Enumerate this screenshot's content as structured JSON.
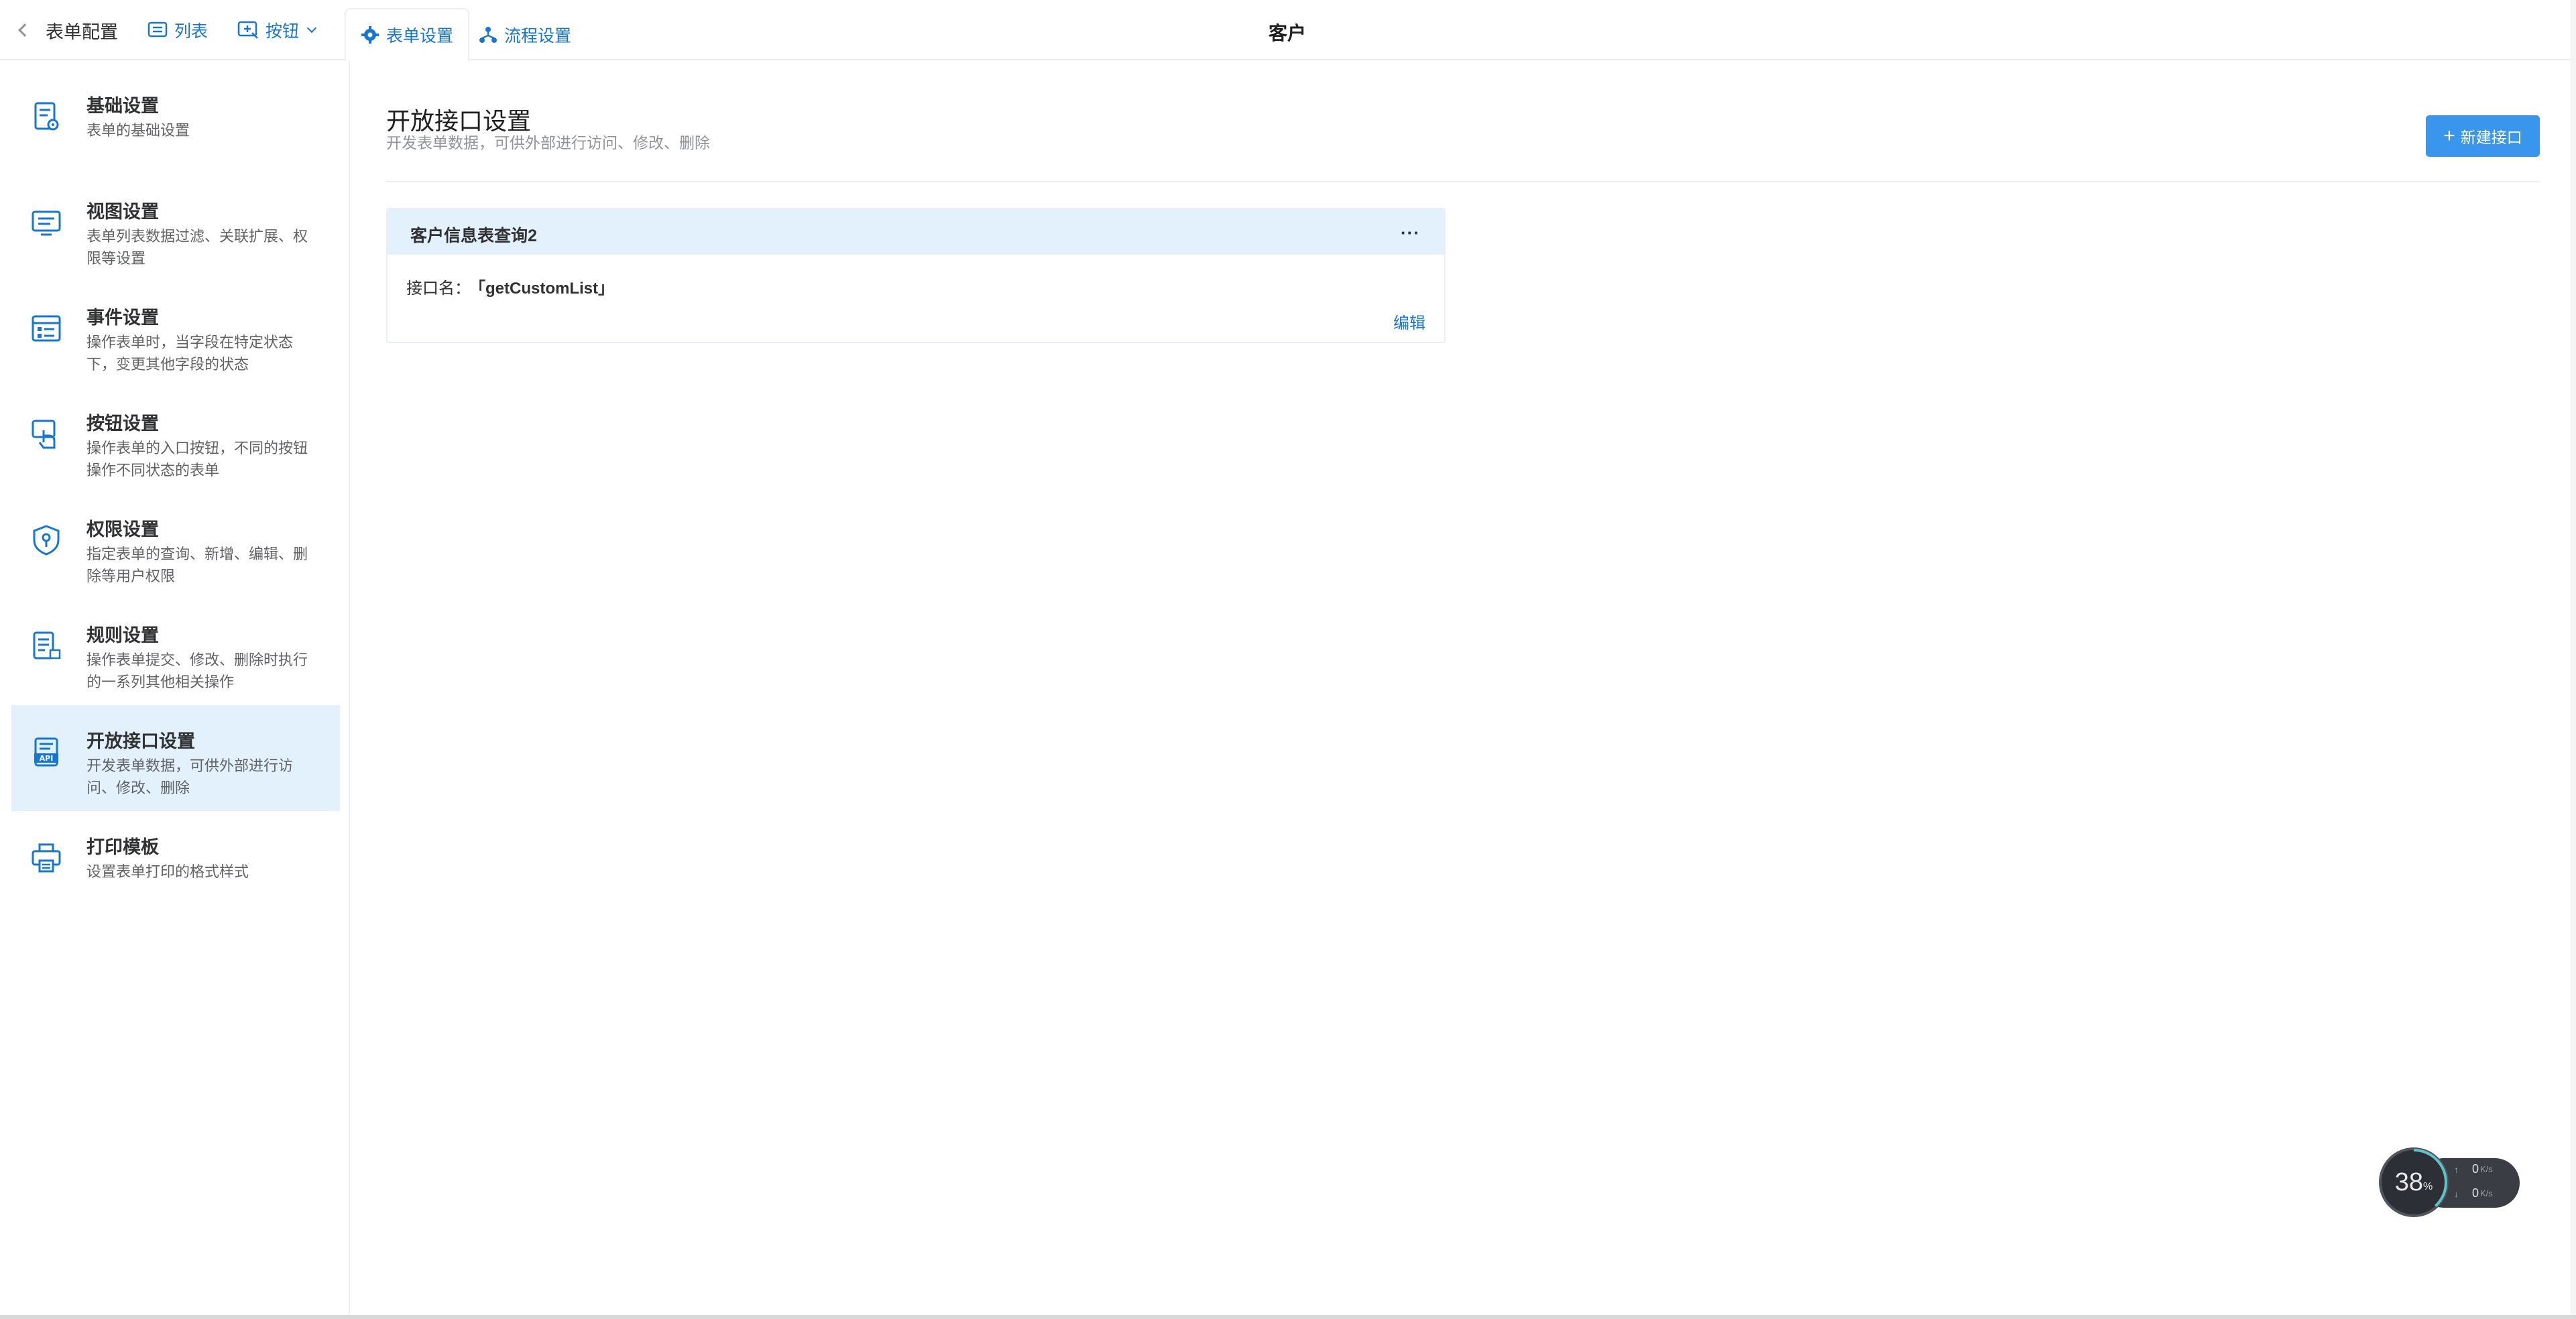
{
  "topbar": {
    "back_label": "表单配置",
    "list_label": "列表",
    "button_label": "按钮",
    "tabs": [
      {
        "label": "表单设置"
      },
      {
        "label": "流程设置"
      }
    ],
    "page_title": "客户"
  },
  "sidebar": {
    "items": [
      {
        "title": "基础设置",
        "desc": "表单的基础设置",
        "icon": "form-settings-icon"
      },
      {
        "title": "视图设置",
        "desc": "表单列表数据过滤、关联扩展、权限等设置",
        "icon": "monitor-icon"
      },
      {
        "title": "事件设置",
        "desc": "操作表单时，当字段在特定状态下，变更其他字段的状态",
        "icon": "event-icon"
      },
      {
        "title": "按钮设置",
        "desc": "操作表单的入口按钮，不同的按钮操作不同状态的表单",
        "icon": "hand-click-icon"
      },
      {
        "title": "权限设置",
        "desc": "指定表单的查询、新增、编辑、删除等用户权限",
        "icon": "shield-icon"
      },
      {
        "title": "规则设置",
        "desc": "操作表单提交、修改、删除时执行的一系列其他相关操作",
        "icon": "rules-icon"
      },
      {
        "title": "开放接口设置",
        "desc": "开发表单数据，可供外部进行访问、修改、删除",
        "icon": "api-icon"
      },
      {
        "title": "打印模板",
        "desc": "设置表单打印的格式样式",
        "icon": "printer-icon"
      }
    ],
    "active_index": 6
  },
  "main": {
    "title": "开放接口设置",
    "desc": "开发表单数据，可供外部进行访问、修改、删除",
    "new_button": "新建接口",
    "card": {
      "title": "客户信息表查询2",
      "more": "···",
      "field_label": "接口名：",
      "field_value": "「getCustomList」",
      "edit_label": "编辑"
    }
  },
  "widget": {
    "percent": "38",
    "percent_unit": "%",
    "up_value": "0",
    "down_value": "0",
    "unit": "K/s"
  },
  "colors": {
    "accent": "#1677d2",
    "primary_button": "#3a96ed",
    "active_bg": "#e3f1fd"
  }
}
